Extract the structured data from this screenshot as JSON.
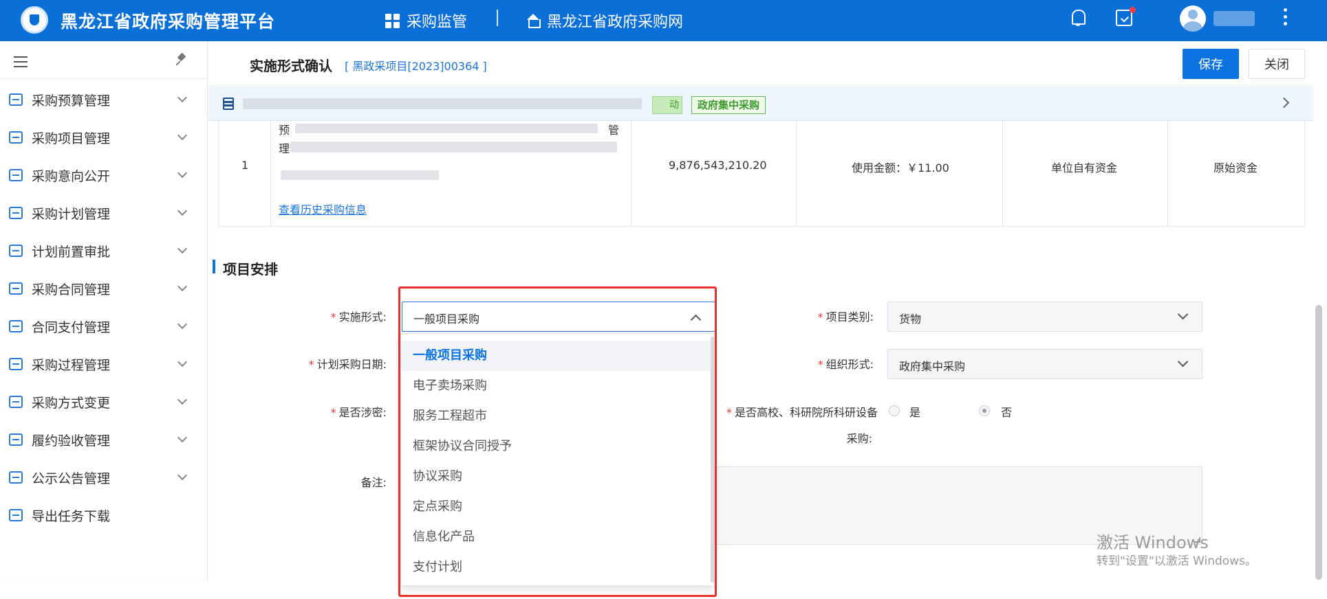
{
  "header": {
    "app_title": "黑龙江省政府采购管理平台",
    "nav": [
      {
        "label": "采购监管"
      },
      {
        "label": "黑龙江省政府采购网"
      }
    ]
  },
  "sidebar": {
    "items": [
      {
        "label": "采购预算管理"
      },
      {
        "label": "采购项目管理"
      },
      {
        "label": "采购意向公开"
      },
      {
        "label": "采购计划管理"
      },
      {
        "label": "计划前置审批"
      },
      {
        "label": "采购合同管理"
      },
      {
        "label": "合同支付管理"
      },
      {
        "label": "采购过程管理"
      },
      {
        "label": "采购方式变更"
      },
      {
        "label": "履约验收管理"
      },
      {
        "label": "公示公告管理"
      },
      {
        "label": "导出任务下载"
      }
    ]
  },
  "page": {
    "title": "实施形式确认",
    "project_code": "[ 黑政采项目[2023]00364 ]",
    "save_label": "保存",
    "close_label": "关闭"
  },
  "info_strip": {
    "tag_partial": "动",
    "tag": "政府集中采购"
  },
  "table_row": {
    "index": "1",
    "history_link": "查看历史采购信息",
    "amount": "9,876,543,210.20",
    "used_amount": "使用金额：￥11.00",
    "fund_source": "单位自有资金",
    "fund_type": "原始资金",
    "text_fragment_1": "预",
    "text_fragment_2": "理",
    "text_fragment_3": "管"
  },
  "section": {
    "title": "项目安排"
  },
  "form": {
    "impl_form_label": "实施形式:",
    "impl_form_value": "一般项目采购",
    "plan_date_label": "计划采购日期:",
    "secret_label": "是否涉密:",
    "remark_label": "备注:",
    "category_label": "项目类别:",
    "category_value": "货物",
    "org_form_label": "组织形式:",
    "org_form_value": "政府集中采购",
    "research_label_1": "是否高校、科研院所科研设备",
    "research_label_2": "采购:",
    "yes_label": "是",
    "no_label": "否"
  },
  "dropdown": {
    "options": [
      {
        "label": "一般项目采购",
        "selected": true
      },
      {
        "label": "电子卖场采购"
      },
      {
        "label": "服务工程超市"
      },
      {
        "label": "框架协议合同授予"
      },
      {
        "label": "协议采购"
      },
      {
        "label": "定点采购"
      },
      {
        "label": "信息化产品"
      },
      {
        "label": "支付计划"
      }
    ]
  },
  "watermark": {
    "line1": "激活 Windows",
    "line2": "转到\"设置\"以激活 Windows。"
  },
  "colors": {
    "brand": "#0a6fd6",
    "highlight": "#e8302d"
  }
}
